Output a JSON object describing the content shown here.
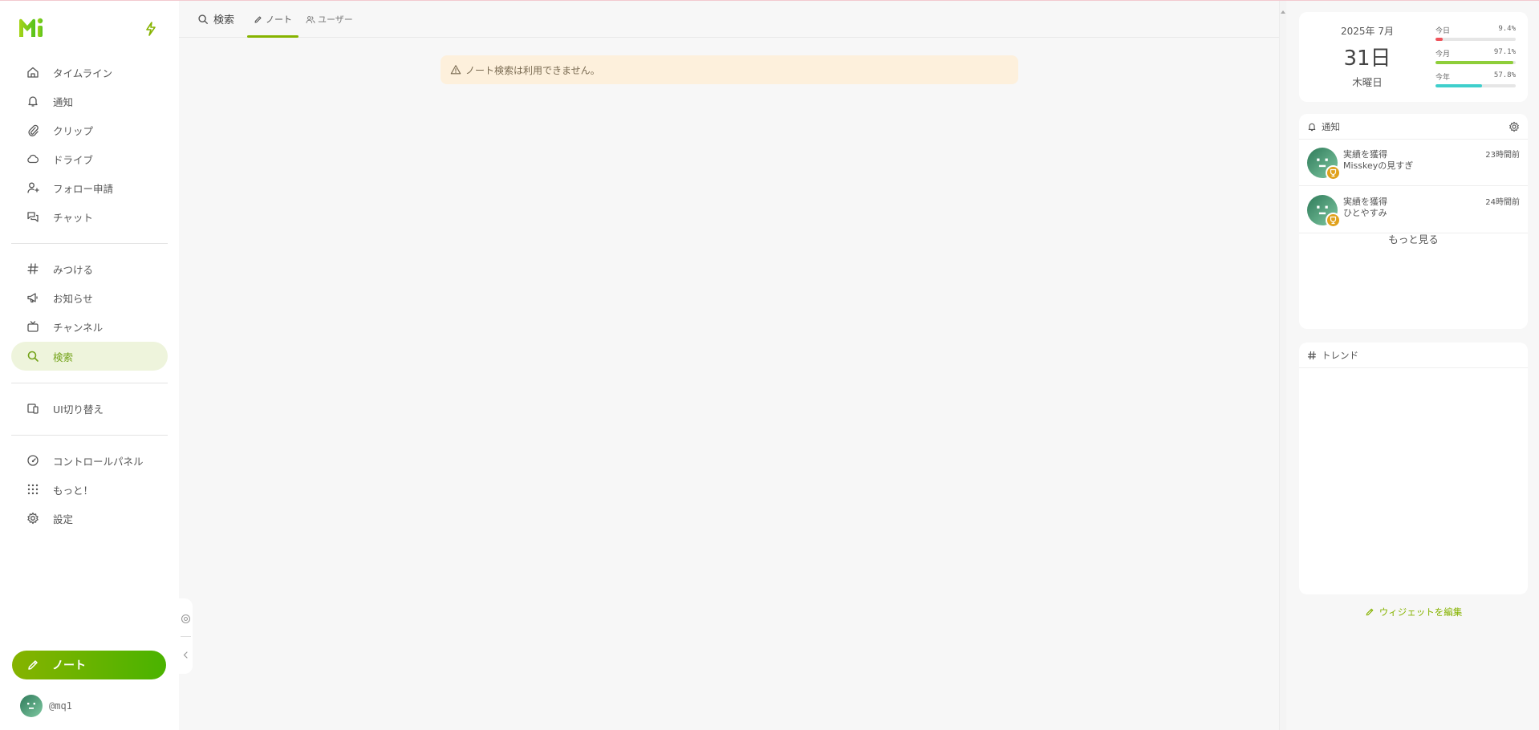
{
  "app": {
    "name": "Misskey"
  },
  "sidebar": {
    "items": [
      {
        "label": "タイムライン",
        "icon": "home-icon"
      },
      {
        "label": "通知",
        "icon": "bell-icon"
      },
      {
        "label": "クリップ",
        "icon": "paperclip-icon"
      },
      {
        "label": "ドライブ",
        "icon": "cloud-icon"
      },
      {
        "label": "フォロー申請",
        "icon": "user-plus-icon"
      },
      {
        "label": "チャット",
        "icon": "chat-icon"
      },
      {
        "label": "みつける",
        "icon": "hashtag-icon"
      },
      {
        "label": "お知らせ",
        "icon": "megaphone-icon"
      },
      {
        "label": "チャンネル",
        "icon": "tv-icon"
      },
      {
        "label": "検索",
        "icon": "search-icon",
        "active": true
      },
      {
        "label": "UI切り替え",
        "icon": "devices-icon"
      },
      {
        "label": "コントロールパネル",
        "icon": "gauge-icon"
      },
      {
        "label": "もっと！",
        "icon": "grid-dots-icon"
      },
      {
        "label": "設定",
        "icon": "settings-icon"
      }
    ],
    "note_button": "ノート",
    "account": "@mq1"
  },
  "header": {
    "title": "検索",
    "tabs": [
      {
        "label": "ノート",
        "active": true
      },
      {
        "label": "ユーザー",
        "active": false
      }
    ]
  },
  "main": {
    "warning": "ノート検索は利用できません。"
  },
  "widgets": {
    "calendar": {
      "year_month": "2025年 7月",
      "day": "31日",
      "weekday": "木曜日",
      "progress": [
        {
          "label": "今日",
          "value": "9.4%",
          "fraction": 0.094,
          "color": "#f0535b"
        },
        {
          "label": "今月",
          "value": "97.1%",
          "fraction": 0.971,
          "color": "#8ece3a"
        },
        {
          "label": "今年",
          "value": "57.8%",
          "fraction": 0.578,
          "color": "#3fcfcc"
        }
      ]
    },
    "notifications": {
      "title": "通知",
      "items": [
        {
          "title": "実績を獲得",
          "subtitle": "Misskeyの見すぎ",
          "time": "23時間前"
        },
        {
          "title": "実績を獲得",
          "subtitle": "ひとやすみ",
          "time": "24時間前"
        }
      ],
      "more": "もっと見る"
    },
    "trend": {
      "title": "トレンド"
    },
    "edit": "ウィジェットを編集"
  },
  "colors": {
    "accent": "#86b300",
    "accent2": "#4ab300",
    "warning_bg": "#fdf0dc",
    "badge": "#e0a11b"
  }
}
